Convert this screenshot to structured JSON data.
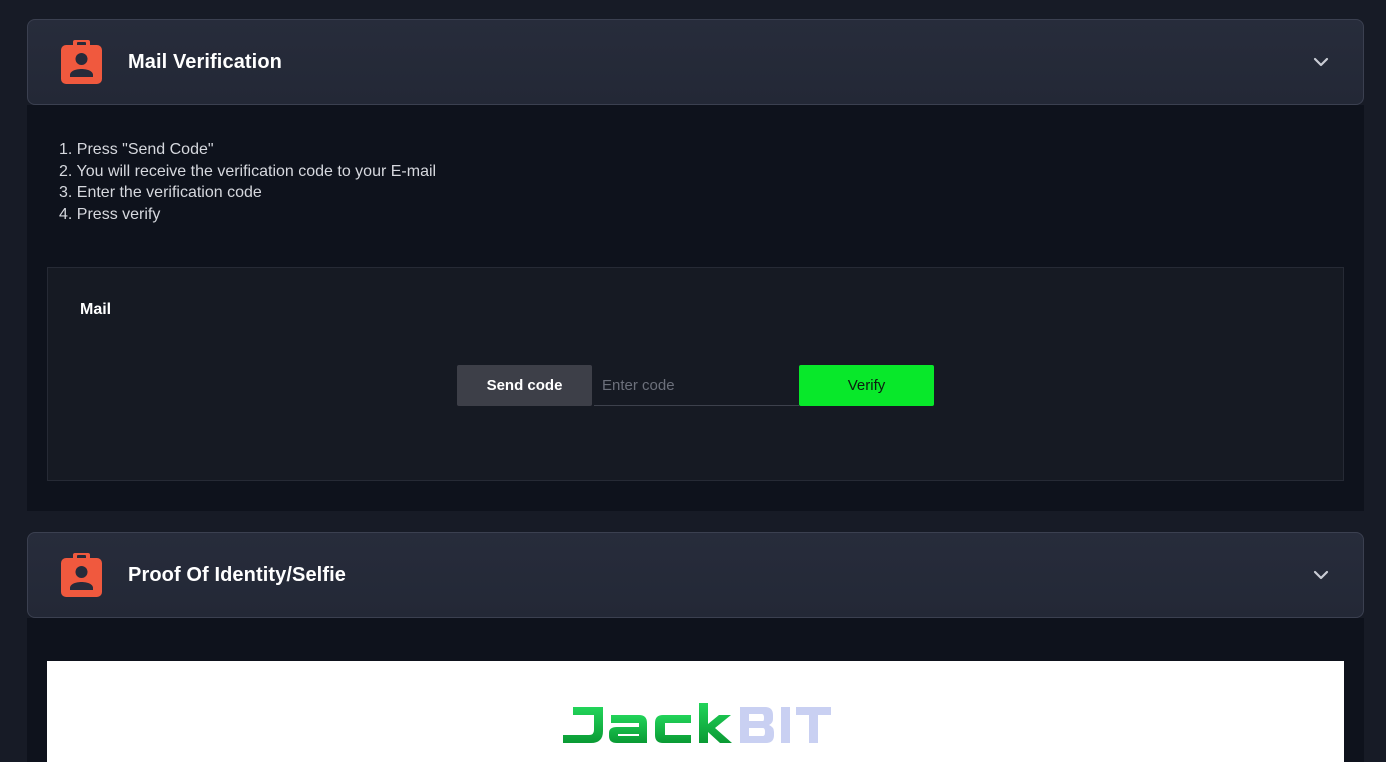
{
  "sections": {
    "mail": {
      "title": "Mail Verification",
      "steps": [
        "1. Press \"Send Code\"",
        "2. You will receive the verification code to your E-mail",
        "3. Enter the verification code",
        "4. Press verify"
      ],
      "card_label": "Mail",
      "send_button": "Send code",
      "code_placeholder": "Enter code",
      "code_value": "",
      "verify_button": "Verify"
    },
    "identity": {
      "title": "Proof Of Identity/Selfie",
      "logo_text": "JACKBIT"
    }
  },
  "icons": {
    "section_badge": "id-badge-icon",
    "expand": "chevron-down-icon"
  },
  "colors": {
    "page_bg": "#171b26",
    "header_bg": "#262b3a",
    "body_bg": "#0e121c",
    "card_bg": "#161a23",
    "badge": "#f0593e",
    "verify_green": "#08e82a",
    "send_gray": "#3d3f48",
    "logo_green": "#0ec042",
    "logo_lavender": "#c9d0f2"
  }
}
